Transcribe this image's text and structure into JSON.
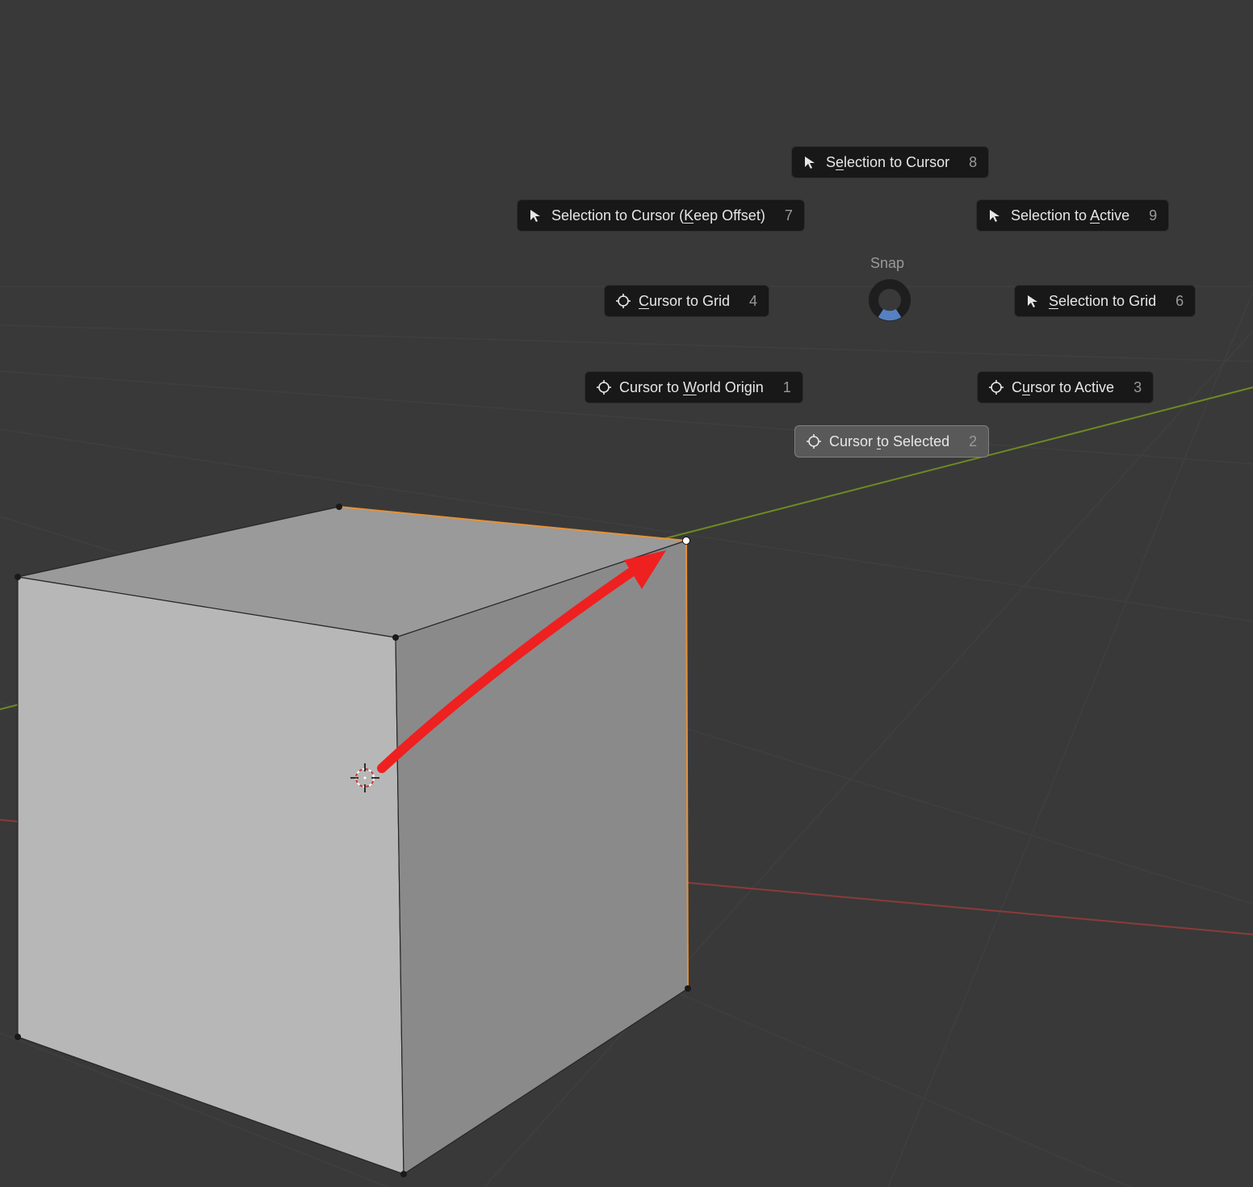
{
  "pie": {
    "title": "Snap",
    "items": {
      "selection_to_cursor": {
        "pre": "S",
        "u": "e",
        "post": "lection to Cursor",
        "key": "8"
      },
      "selection_keep_offset": {
        "pre": "Selection to Cursor (",
        "u": "K",
        "post": "eep Offset)",
        "key": "7"
      },
      "selection_to_active": {
        "pre": "Selection to ",
        "u": "A",
        "post": "ctive",
        "key": "9"
      },
      "cursor_to_grid": {
        "pre": "",
        "u": "C",
        "post": "ursor to Grid",
        "key": "4"
      },
      "selection_to_grid": {
        "pre": "",
        "u": "S",
        "post": "election to Grid",
        "key": "6"
      },
      "cursor_world_origin": {
        "pre": "Cursor to ",
        "u": "W",
        "post": "orld Origin",
        "key": "1"
      },
      "cursor_to_active": {
        "pre": "C",
        "u": "u",
        "post": "rsor to Active",
        "key": "3"
      },
      "cursor_to_selected": {
        "pre": "Cursor ",
        "u": "t",
        "post": "o Selected",
        "key": "2"
      }
    }
  }
}
